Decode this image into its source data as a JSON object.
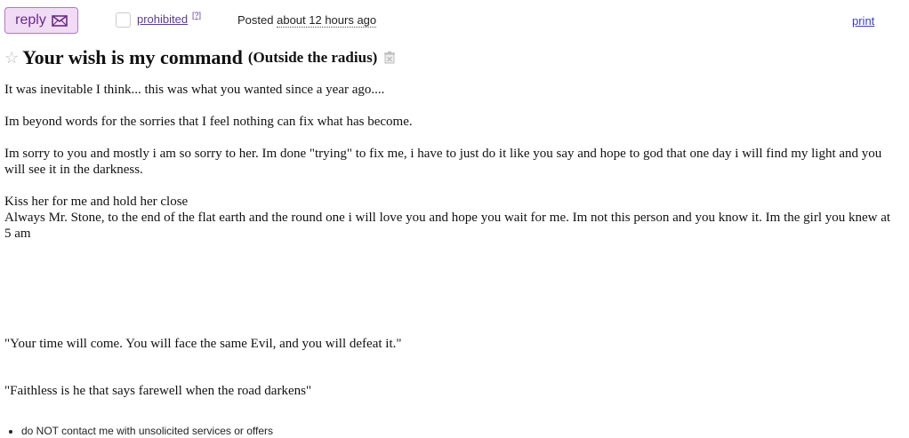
{
  "toolbar": {
    "reply_label": "reply",
    "flag_label": "prohibited",
    "flag_help": "[?]",
    "posted_prefix": "Posted",
    "posted_time": "about 12 hours ago",
    "print_label": "print"
  },
  "posting": {
    "title": "Your wish is my command",
    "location": "(Outside the radius)"
  },
  "body": {
    "lines": [
      "It was inevitable I think... this was what you wanted since a year ago....",
      "Im beyond words for the sorries that I feel nothing can fix what has become.",
      "Im sorry to you and mostly i am so sorry to her. Im done \"trying\" to fix me, i have to just do it like you say and hope to god that one day i will find my light and you will see it in the darkness.",
      "Kiss her for me and hold her close",
      "Always Mr. Stone, to the end of the flat earth and the round one i will love you and hope you wait for me. Im not this person and you know it. Im the girl you knew at 5 am",
      "\"Your time will come. You will face the same Evil, and you will defeat it.\"",
      "\"Faithless is he that says farewell when the road darkens\""
    ]
  },
  "notices": [
    "do NOT contact me with unsolicited services or offers"
  ],
  "colors": {
    "reply_bg": "#f1dcf5",
    "reply_border": "#b07bc0",
    "reply_text": "#6a2a8a",
    "link_purple": "#5a3aa0",
    "link_blue": "#3a3ad0"
  },
  "icons": [
    "envelope-icon",
    "star-icon",
    "hide-icon"
  ]
}
